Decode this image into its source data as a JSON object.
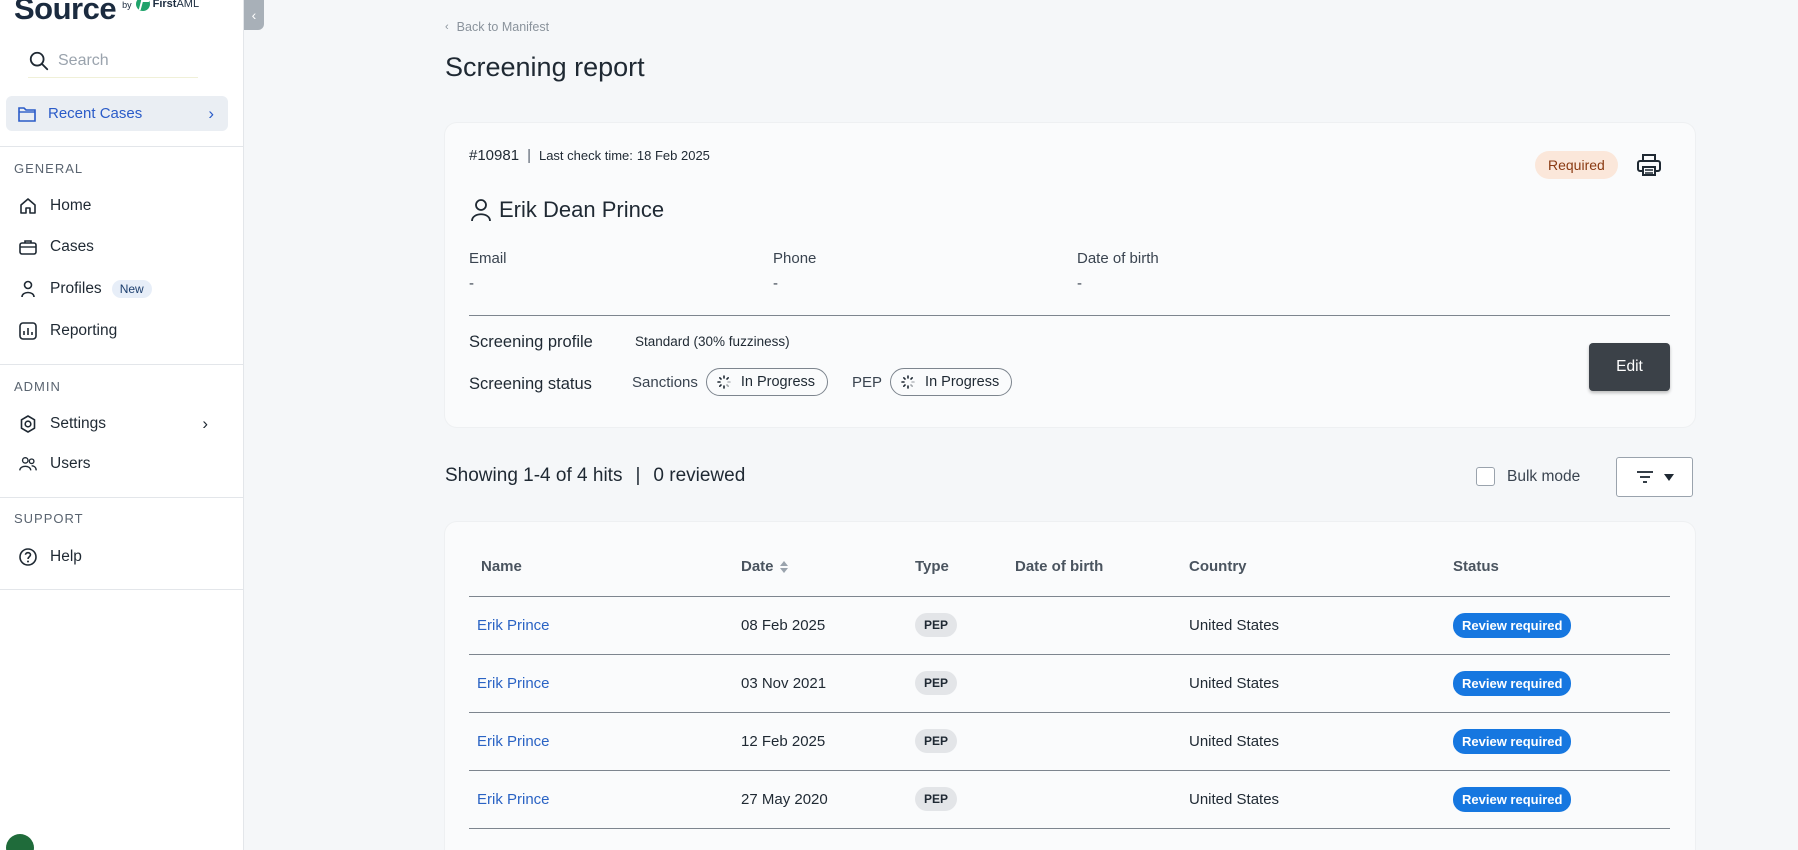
{
  "brand": {
    "name": "Source",
    "by": "by",
    "partner_bold": "First",
    "partner_rest": "AML"
  },
  "sidebar": {
    "collapse_icon": "chevron-left-icon",
    "search": {
      "placeholder": "Search"
    },
    "recent_cases": {
      "label": "Recent Cases"
    },
    "sections": {
      "general": "GENERAL",
      "admin": "ADMIN",
      "support": "SUPPORT"
    },
    "items": {
      "home": "Home",
      "cases": "Cases",
      "profiles": "Profiles",
      "profiles_badge": "New",
      "reporting": "Reporting",
      "settings": "Settings",
      "users": "Users",
      "help": "Help"
    }
  },
  "header": {
    "back_link": "Back to Manifest",
    "title": "Screening report"
  },
  "report": {
    "case_id": "#10981",
    "separator": "|",
    "last_check_label": "Last check time:",
    "last_check_value": "18 Feb 2025",
    "status_badge": "Required",
    "person_name": "Erik Dean Prince",
    "fields": {
      "email_label": "Email",
      "email_value": "-",
      "phone_label": "Phone",
      "phone_value": "-",
      "dob_label": "Date of birth",
      "dob_value": "-"
    },
    "screening_profile_label": "Screening profile",
    "screening_profile_value": "Standard (30% fuzziness)",
    "screening_status_label": "Screening status",
    "sanctions_label": "Sanctions",
    "sanctions_status": "In Progress",
    "pep_label": "PEP",
    "pep_status": "In Progress",
    "edit_label": "Edit"
  },
  "hits_bar": {
    "showing": "Showing 1-4 of 4 hits",
    "separator": "|",
    "reviewed": "0 reviewed",
    "bulk_mode": "Bulk mode",
    "filter_icon": "filter-icon"
  },
  "table": {
    "columns": {
      "name": "Name",
      "date": "Date",
      "type": "Type",
      "dob": "Date of birth",
      "country": "Country",
      "status": "Status"
    },
    "rows": [
      {
        "name": "Erik Prince",
        "date": "08 Feb 2025",
        "type": "PEP",
        "dob": "",
        "country": "United States",
        "status": "Review required"
      },
      {
        "name": "Erik Prince",
        "date": "03 Nov 2021",
        "type": "PEP",
        "dob": "",
        "country": "United States",
        "status": "Review required"
      },
      {
        "name": "Erik Prince",
        "date": "12 Feb 2025",
        "type": "PEP",
        "dob": "",
        "country": "United States",
        "status": "Review required"
      },
      {
        "name": "Erik Prince",
        "date": "27 May 2020",
        "type": "PEP",
        "dob": "",
        "country": "United States",
        "status": "Review required"
      }
    ]
  },
  "colors": {
    "accent_link": "#2a63c4",
    "status_blue": "#1677e0",
    "required_bg": "#fbe7da",
    "edit_button": "#3b4148"
  }
}
